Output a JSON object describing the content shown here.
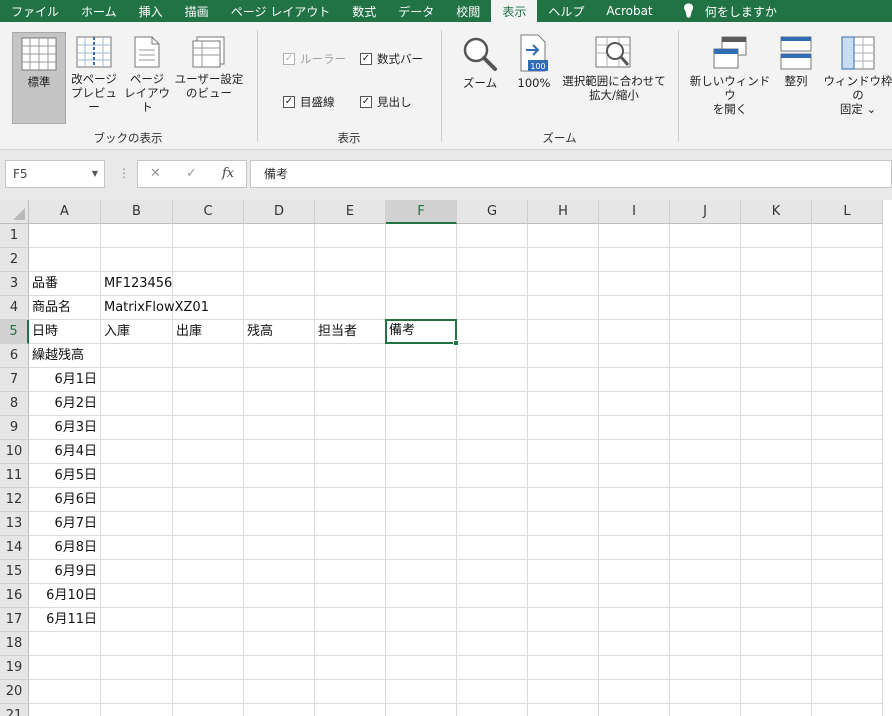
{
  "tabs": [
    "ファイル",
    "ホーム",
    "挿入",
    "描画",
    "ページ レイアウト",
    "数式",
    "データ",
    "校閲",
    "表示",
    "ヘルプ",
    "Acrobat"
  ],
  "active_tab": "表示",
  "tell_me": "何をしますか",
  "ribbon": {
    "workbook_views": {
      "label": "ブックの表示",
      "normal": "標準",
      "page_break": [
        "改ページ",
        "プレビュー"
      ],
      "page_layout": [
        "ページ",
        "レイアウト"
      ],
      "custom_views": [
        "ユーザー設定",
        "のビュー"
      ]
    },
    "show": {
      "label": "表示",
      "ruler": "ルーラー",
      "formula_bar": "数式バー",
      "gridlines": "目盛線",
      "headings": "見出し"
    },
    "zoom": {
      "label": "ズーム",
      "zoom": "ズーム",
      "zoom100": "100%",
      "zoom100_icon_text": "100",
      "zoom_selection": [
        "選択範囲に合わせて",
        "拡大/縮小"
      ]
    },
    "window": {
      "new_window": [
        "新しいウィンドウ",
        "を開く"
      ],
      "arrange": "整列",
      "freeze": [
        "ウィンドウ枠の",
        "固定 ⌄"
      ]
    }
  },
  "formula_bar": {
    "name_box": "F5",
    "cancel": "✕",
    "enter": "✓",
    "fx": "fx",
    "content": "備考"
  },
  "sheet": {
    "columns": [
      "A",
      "B",
      "C",
      "D",
      "E",
      "F",
      "G",
      "H",
      "I",
      "J",
      "K",
      "L"
    ],
    "selected_column": "F",
    "rows": [
      "1",
      "2",
      "3",
      "4",
      "5",
      "6",
      "7",
      "8",
      "9",
      "10",
      "11",
      "12",
      "13",
      "14",
      "15",
      "16",
      "17",
      "18",
      "19",
      "20",
      "21"
    ],
    "selected_row": "5",
    "active_cell": "F5",
    "cells": {
      "A3": "品番",
      "B3": "MF123456",
      "A4": "商品名",
      "B4": "MatrixFlowXZ01",
      "A5": "日時",
      "B5": "入庫",
      "C5": "出庫",
      "D5": "残高",
      "E5": "担当者",
      "F5": "備考",
      "A6": "繰越残高",
      "A7": "6月1日",
      "A8": "6月2日",
      "A9": "6月3日",
      "A10": "6月4日",
      "A11": "6月5日",
      "A12": "6月6日",
      "A13": "6月7日",
      "A14": "6月8日",
      "A15": "6月9日",
      "A16": "6月10日",
      "A17": "6月11日"
    },
    "right_aligned": [
      "A7",
      "A8",
      "A9",
      "A10",
      "A11",
      "A12",
      "A13",
      "A14",
      "A15",
      "A16",
      "A17"
    ]
  },
  "colors": {
    "excel_green": "#217346",
    "ribbon_bg": "#f3f3f3",
    "grid_line": "#dadada"
  }
}
